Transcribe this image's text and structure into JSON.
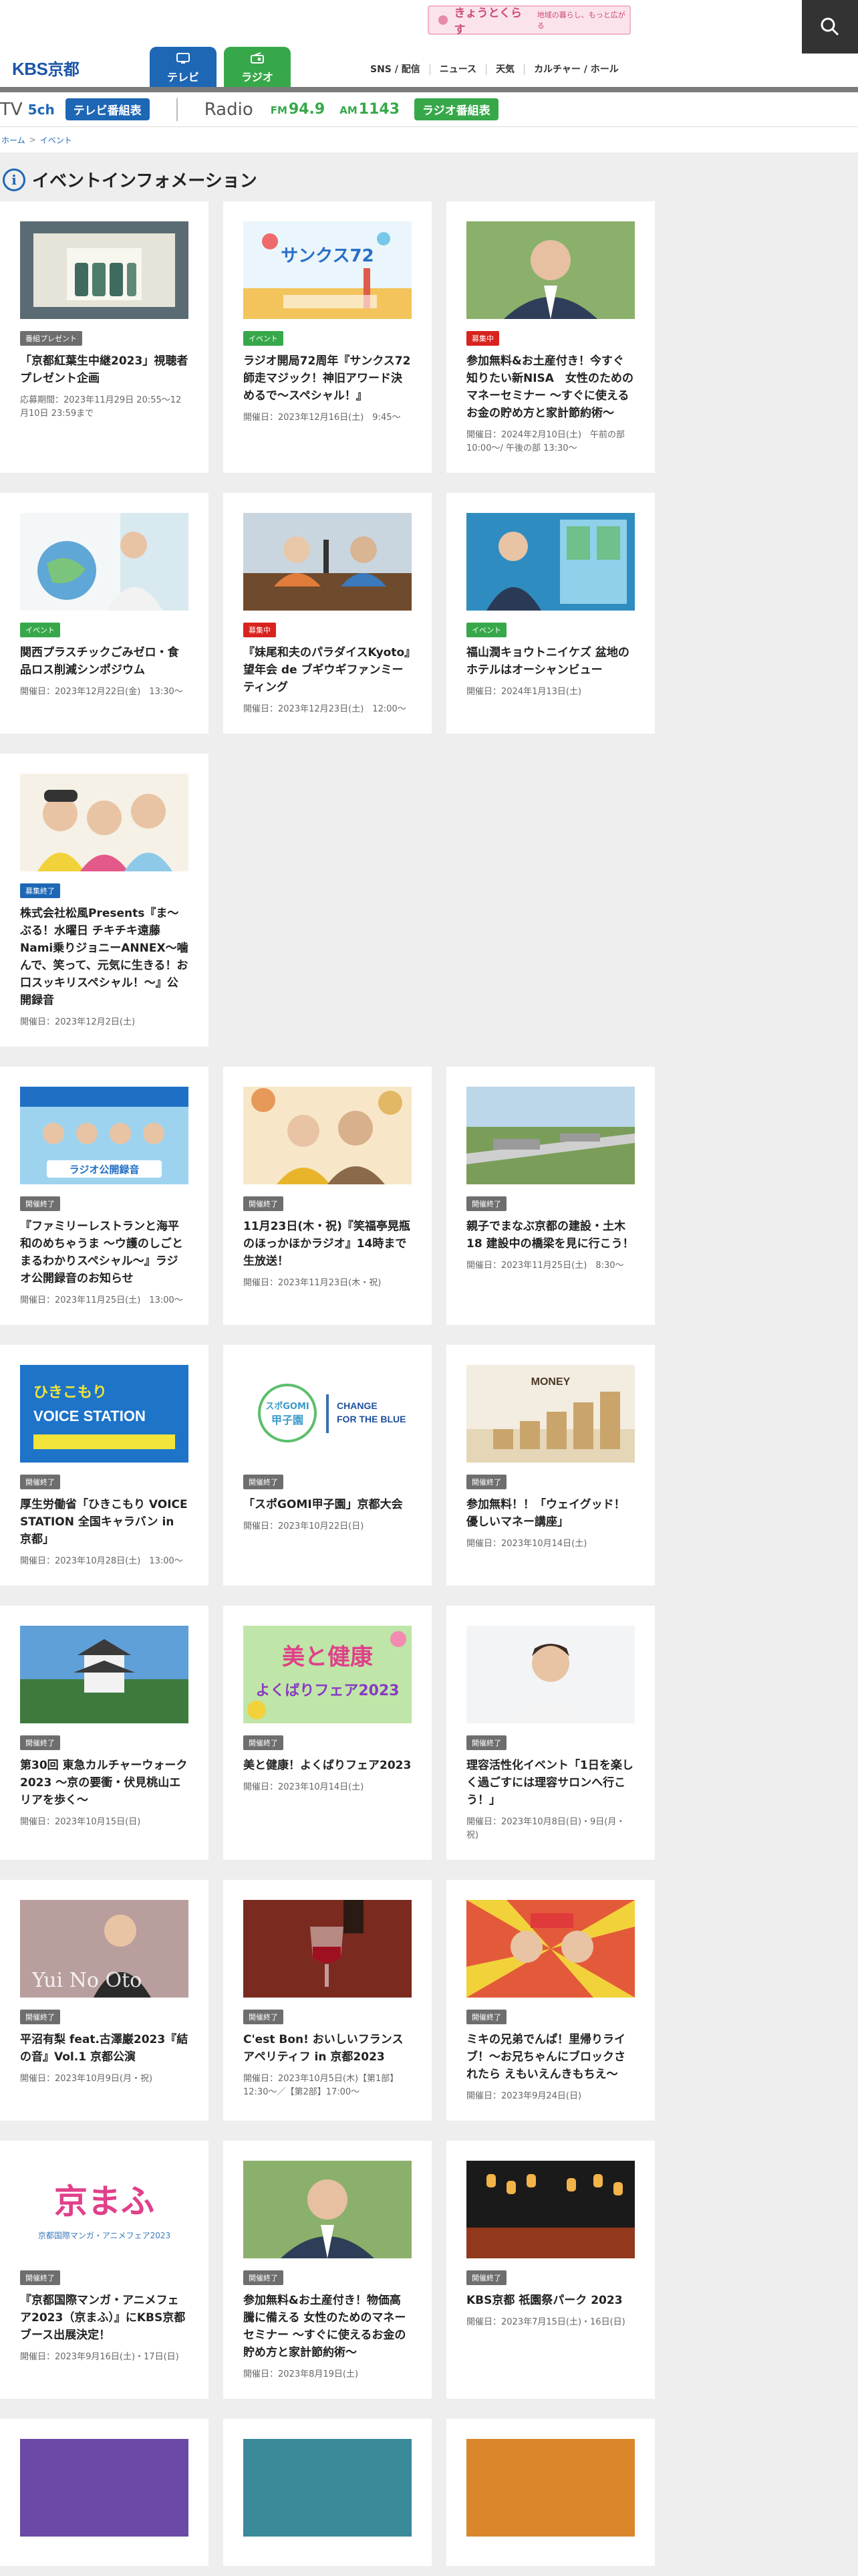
{
  "header": {
    "logo_text": "KBS",
    "logo_kanji": "京都",
    "tabs": [
      {
        "label": "テレビ"
      },
      {
        "label": "ラジオ"
      }
    ],
    "nav": [
      "SNS / 配信",
      "ニュース",
      "天気",
      "カルチャー / ホール"
    ],
    "banner_title": "きょうとくらす",
    "banner_sub": "地域の暮らし、もっと広がる"
  },
  "channels": {
    "tv_label": "TV",
    "tv_channel": "5ch",
    "tv_button": "テレビ番組表",
    "radio_label": "Radio",
    "fm_prefix": "FM",
    "fm": "94.9",
    "am_prefix": "AM",
    "am": "1143",
    "radio_button": "ラジオ番組表"
  },
  "breadcrumb": {
    "home": "ホーム",
    "current": "イベント"
  },
  "page_title": "イベントインフォメーション",
  "cards": [
    {
      "badge": "番組プレゼント",
      "badge_color": "gray",
      "title": "「京都紅葉生中継2023」視聴者プレゼント企画",
      "date": "応募期間：2023年11月29日 20:55〜12月10日 23:59まで",
      "thumb": "gift-box"
    },
    {
      "badge": "イベント",
      "badge_color": "green",
      "title": "ラジオ開局72周年『サンクス72 師走マジック！神旧アワード決めるで〜スペシャル！』",
      "date": "開催日：2023年12月16日(土)　9:45〜",
      "thumb": "thanks72"
    },
    {
      "badge": "募集中",
      "badge_color": "red",
      "title": "参加無料&お土産付き！今すぐ知りたい新NISA　女性のためのマネーセミナー 〜すぐに使えるお金の貯め方と家計節約術〜",
      "date": "開催日：2024年2月10日(土)　午前の部 10:00〜/ 午後の部 13:30〜",
      "thumb": "man-portrait"
    },
    {
      "badge": "イベント",
      "badge_color": "green",
      "title": "関西プラスチックごみゼロ・食品ロス削減シンポジウム",
      "date": "開催日：2023年12月22日(金)　13:30〜",
      "thumb": "globe-woman"
    },
    {
      "badge": "募集中",
      "badge_color": "red",
      "title": "『妹尾和夫のパラダイスKyoto』望年会 de ブギウギファンミーティング",
      "date": "開催日：2023年12月23日(土)　12:00〜",
      "thumb": "radio-studio"
    },
    {
      "badge": "イベント",
      "badge_color": "green",
      "title": "福山潤キョウトニイケズ 盆地のホテルはオーシャンビュー",
      "date": "開催日：2024年1月13日(土)",
      "thumb": "man-window"
    },
    {
      "badge": "募集終了",
      "badge_color": "blue",
      "title": "株式会社松風Presents『ま〜ぶる！水曜日 チキチキ遠藤Nami乗りジョニーANNEX〜噛んで、笑って、元気に生きる！お口スッキリスペシャル！〜』公開録音",
      "date": "開催日：2023年12月2日(土)",
      "thumb": "three-people"
    },
    {
      "badge": "開催終了",
      "badge_color": "gray",
      "title": "『ファミリーレストランと海平和のめちゃうま 〜ウ護のしごとまるわかりスペシャル〜』ラジオ公開録音のお知らせ",
      "date": "開催日：2023年11月25日(土)　13:00〜",
      "thumb": "radio-recording"
    },
    {
      "badge": "開催終了",
      "badge_color": "gray",
      "title": "11月23日(木・祝)『笑福亭晃瓶のほっかほかラジオ』14時まで生放送！",
      "date": "開催日：2023年11月23日(木・祝)",
      "thumb": "autumn-duo"
    },
    {
      "badge": "開催終了",
      "badge_color": "gray",
      "title": "親子でまなぶ京都の建設・土木18 建設中の橋梁を見に行こう！",
      "date": "開催日：2023年11月25日(土)　8:30〜",
      "thumb": "highway"
    },
    {
      "badge": "開催終了",
      "badge_color": "gray",
      "title": "厚生労働省「ひきこもり VOICE STATION 全国キャラバン in 京都」",
      "date": "開催日：2023年10月28日(土)　13:00〜",
      "thumb": "voice-station"
    },
    {
      "badge": "開催終了",
      "badge_color": "gray",
      "title": "「スポGOMI甲子園」京都大会",
      "date": "開催日：2023年10月22日(日)",
      "thumb": "spogomi"
    },
    {
      "badge": "開催終了",
      "badge_color": "gray",
      "title": "参加無料！！「ウェイグッド！優しいマネー講座」",
      "date": "開催日：2023年10月14日(土)",
      "thumb": "money-blocks"
    },
    {
      "badge": "開催終了",
      "badge_color": "gray",
      "title": "第30回 東急カルチャーウォーク2023 〜京の要衝・伏見桃山エリアを歩く〜",
      "date": "開催日：2023年10月15日(日)",
      "thumb": "castle"
    },
    {
      "badge": "開催終了",
      "badge_color": "gray",
      "title": "美と健康！よくばりフェア2023",
      "date": "開催日：2023年10月14日(土)",
      "thumb": "beauty-fair"
    },
    {
      "badge": "開催終了",
      "badge_color": "gray",
      "title": "理容活性化イベント「1日を楽しく過ごすには理容サロンへ行こう！」",
      "date": "開催日：2023年10月8日(日)・9日(月・祝)",
      "thumb": "woman-salon"
    },
    {
      "badge": "開催終了",
      "badge_color": "gray",
      "title": "平沼有梨 feat.古澤巌2023『結の音』Vol.1 京都公演",
      "date": "開催日：2023年10月9日(月・祝)",
      "thumb": "yui-no-oto"
    },
    {
      "badge": "開催終了",
      "badge_color": "gray",
      "title": "C'est Bon! おいしいフランス アペリティフ in 京都2023",
      "date": "開催日：2023年10月5日(木)【第1部】12:30〜／【第2部】17:00〜",
      "thumb": "wine"
    },
    {
      "badge": "開催終了",
      "badge_color": "gray",
      "title": "ミキの兄弟でんぱ！里帰りライブ！〜お兄ちゃんにブロックされたら えもいえんきもちえ〜",
      "date": "開催日：2023年9月24日(日)",
      "thumb": "miki-live"
    },
    {
      "badge": "開催終了",
      "badge_color": "gray",
      "title": "『京都国際マンガ・アニメフェア2023（京まふ）』にKBS京都ブース出展決定！",
      "date": "開催日：2023年9月16日(土)・17日(日)",
      "thumb": "kyomafu"
    },
    {
      "badge": "開催終了",
      "badge_color": "gray",
      "title": "参加無料&お土産付き！物価高騰に備える 女性のためのマネーセミナー 〜すぐに使えるお金の貯め方と家計節約術〜",
      "date": "開催日：2023年8月19日(土)",
      "thumb": "man-portrait"
    },
    {
      "badge": "開催終了",
      "badge_color": "gray",
      "title": "KBS京都 祇園祭パーク 2023",
      "date": "開催日：2023年7月15日(土)・16日(日)",
      "thumb": "gion-lanterns"
    },
    {
      "badge": "",
      "badge_color": "gray",
      "title": "",
      "date": "",
      "thumb": "purple-partial"
    },
    {
      "badge": "",
      "badge_color": "gray",
      "title": "",
      "date": "",
      "thumb": "teal-partial"
    },
    {
      "badge": "",
      "badge_color": "gray",
      "title": "",
      "date": "",
      "thumb": "orange-partial"
    }
  ],
  "thumb_texts": {
    "thanks72": "サンクス72",
    "radio_recording": "ラジオ公開録音",
    "voice_station": "VOICE STATION",
    "spogomi": "スポGOMI甲子園",
    "change_blue": "CHANGE FOR THE BLUE",
    "money": "MONEY",
    "beauty": "美と健康",
    "beauty_sub": "よくばりフェア2023",
    "yui": "Yui No Oto",
    "kyomafu": "京まふ",
    "kyomafu_sub": "京都国際マンガ・アニメフェア2023"
  }
}
